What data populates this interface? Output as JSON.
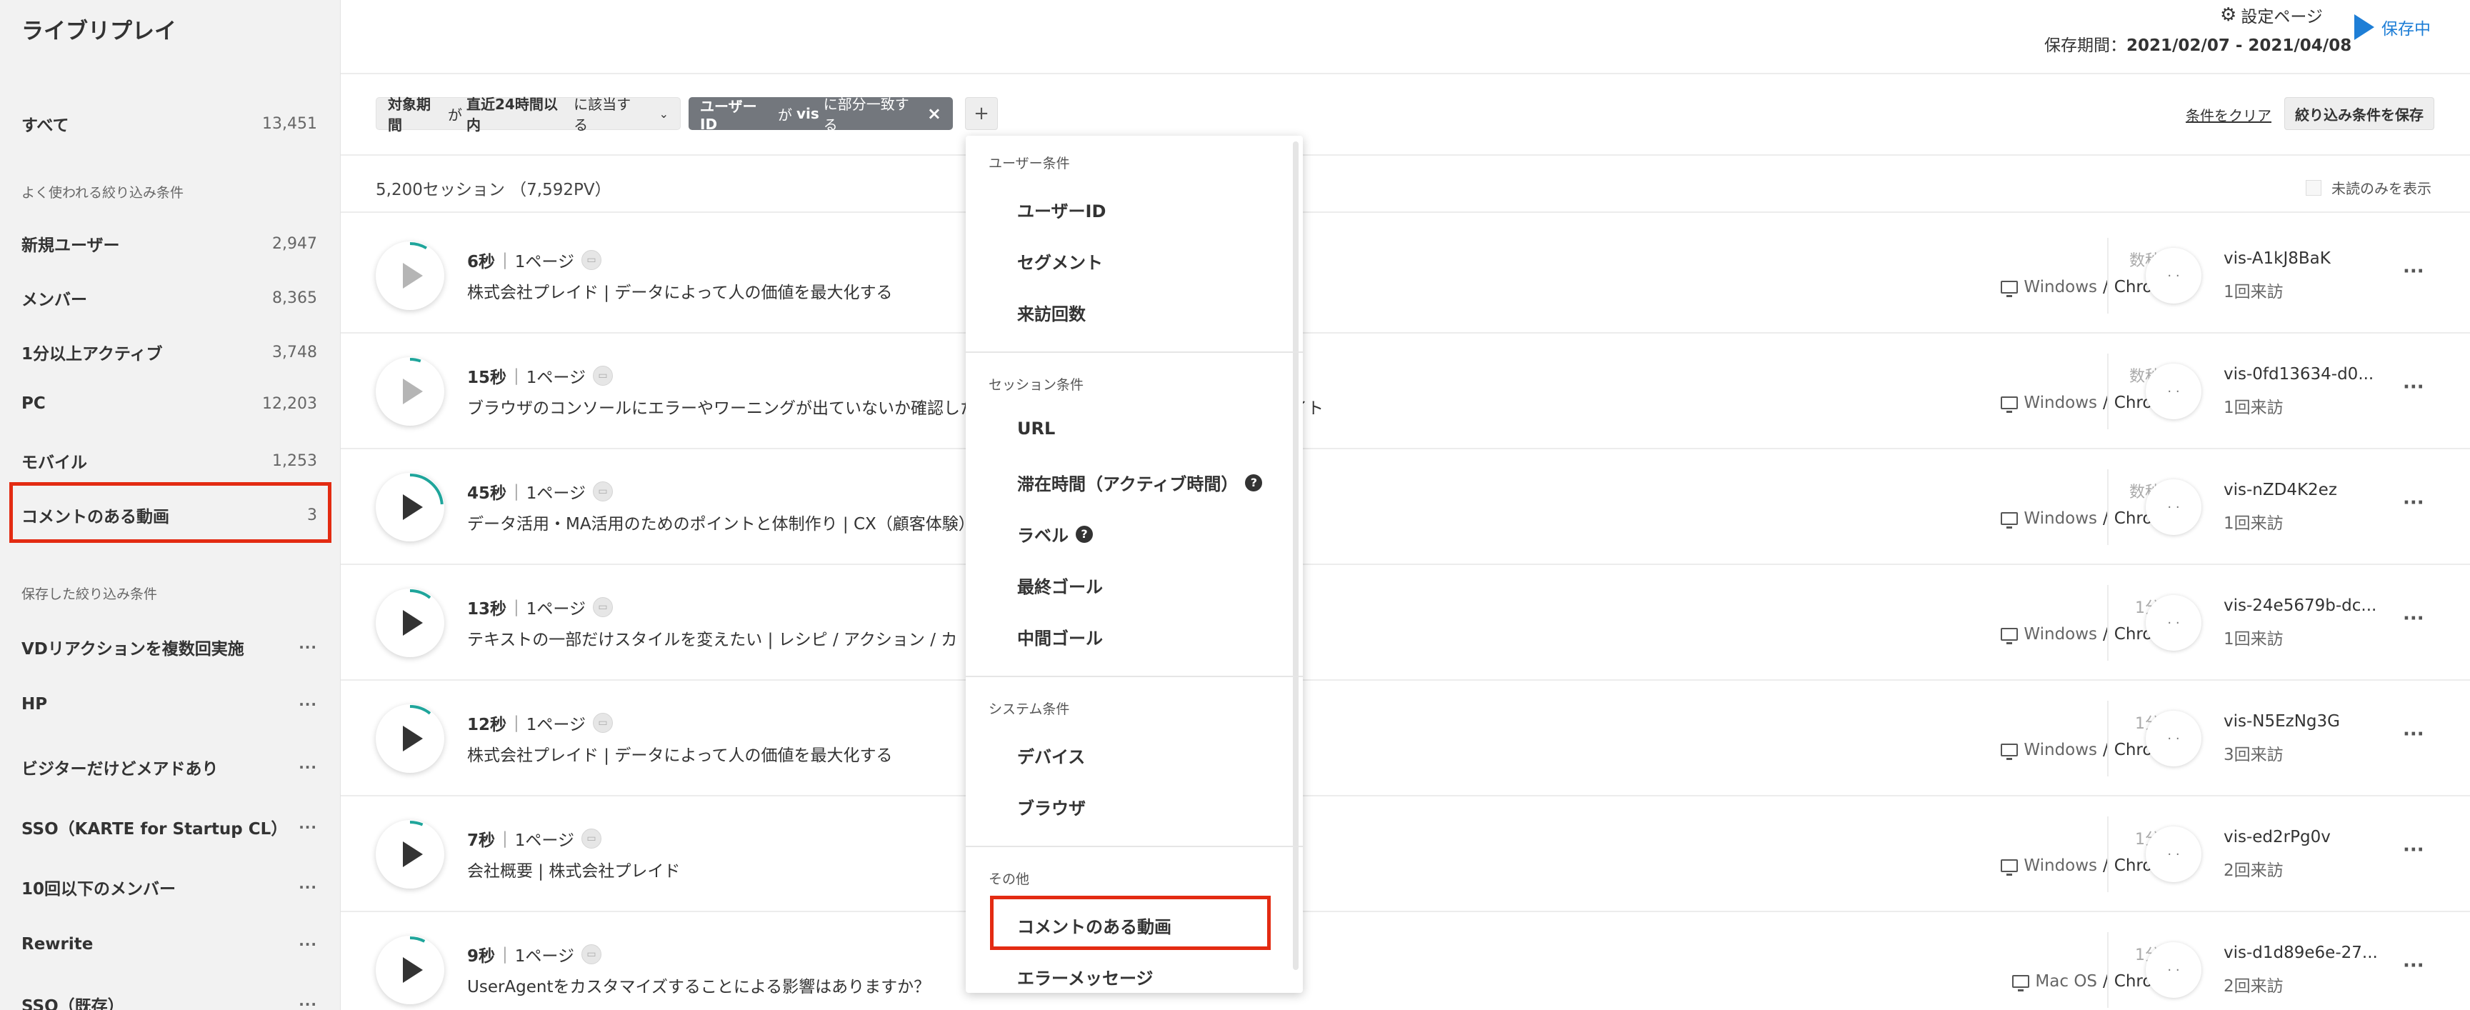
{
  "app": {
    "title": "ライブリプレイ"
  },
  "header": {
    "settings_label": "設定ページ",
    "period_label": "保存期間：",
    "period_value": "2021/02/07 - 2021/04/08",
    "saving_label": "保存中"
  },
  "sidebar": {
    "all": {
      "label": "すべて",
      "count": "13,451"
    },
    "frequent_title": "よく使われる絞り込み条件",
    "frequent": [
      {
        "label": "新規ユーザー",
        "count": "2,947"
      },
      {
        "label": "メンバー",
        "count": "8,365"
      },
      {
        "label": "1分以上アクティブ",
        "count": "3,748"
      },
      {
        "label": "PC",
        "count": "12,203"
      },
      {
        "label": "モバイル",
        "count": "1,253"
      },
      {
        "label": "コメントのある動画",
        "count": "3"
      }
    ],
    "saved_title": "保存した絞り込み条件",
    "saved": [
      {
        "label": "VDリアクションを複数回実施",
        "more": "···"
      },
      {
        "label": "HP",
        "more": "···"
      },
      {
        "label": "ビジターだけどメアドあり",
        "more": "···"
      },
      {
        "label": "SSO（KARTE for Startup CL）",
        "more": "···"
      },
      {
        "label": "10回以下のメンバー",
        "more": "···"
      },
      {
        "label": "Rewrite",
        "more": "···"
      },
      {
        "label": "SSO（既存）",
        "more": "···"
      }
    ]
  },
  "filters": {
    "chip1": {
      "field": "対象期間",
      "ga": "が",
      "value": "直近24時間以内",
      "op": "に該当する"
    },
    "chip2": {
      "field": "ユーザーID",
      "ga": "が",
      "value": "vis",
      "op": "に部分一致する"
    },
    "add": "+",
    "clear": "条件をクリア",
    "save": "絞り込み条件を保存"
  },
  "list": {
    "summary": "5,200セッション （7,592PV）",
    "unread_only": "未読のみを表示",
    "sessions": [
      {
        "duration": "6秒",
        "pages": "1ページ",
        "title": "株式会社プレイド | データによって人の価値を最大化する",
        "time": "数秒前",
        "os": "Windows",
        "browser": "Chrome",
        "vis_id": "vis-A1kJ8BaK",
        "visits": "1回来訪",
        "progress": 0.08
      },
      {
        "duration": "15秒",
        "pages": "1ページ",
        "title": "ブラウザのコンソールにエラーやワーニングが出ていないか確認したい | トラブルシュート | KARTEサポートサイト",
        "time": "数秒前",
        "os": "Windows",
        "browser": "Chrome",
        "vis_id": "vis-0fd13634-d0...",
        "visits": "1回来訪",
        "progress": 0.05
      },
      {
        "duration": "45秒",
        "pages": "1ページ",
        "title": "データ活用・MA活用のためのポイントと体制作り | CX（顧客体験）",
        "time": "数秒前",
        "os": "Windows",
        "browser": "Chrome",
        "vis_id": "vis-nZD4K2ez",
        "visits": "1回来訪",
        "progress": 0.22
      },
      {
        "duration": "13秒",
        "pages": "1ページ",
        "title": "テキストの一部だけスタイルを変えたい | レシピ / アクション / カ",
        "time": "1分前",
        "os": "Windows",
        "browser": "Chrome",
        "vis_id": "vis-24e5679b-dc...",
        "visits": "1回来訪",
        "progress": 0.1
      },
      {
        "duration": "12秒",
        "pages": "1ページ",
        "title": "株式会社プレイド | データによって人の価値を最大化する",
        "time": "1分前",
        "os": "Windows",
        "browser": "Chrome",
        "vis_id": "vis-N5EzNg3G",
        "visits": "3回来訪",
        "progress": 0.1
      },
      {
        "duration": "7秒",
        "pages": "1ページ",
        "title": "会社概要 | 株式会社プレイド",
        "time": "1分前",
        "os": "Windows",
        "browser": "Chrome",
        "vis_id": "vis-ed2rPg0v",
        "visits": "2回来訪",
        "progress": 0.06
      },
      {
        "duration": "9秒",
        "pages": "1ページ",
        "title": "UserAgentをカスタマイズすることによる影響はありますか？",
        "time": "1分前",
        "os": "Mac OS",
        "browser": "Chrome",
        "vis_id": "vis-d1d89e6e-27...",
        "visits": "2回来訪",
        "progress": 0.07
      }
    ]
  },
  "dropdown": {
    "user_title": "ユーザー条件",
    "user_items": [
      "ユーザーID",
      "セグメント",
      "来訪回数"
    ],
    "session_title": "セッション条件",
    "session_items": [
      "URL",
      "滞在時間（アクティブ時間）",
      "ラベル",
      "最終ゴール",
      "中間ゴール"
    ],
    "system_title": "システム条件",
    "system_items": [
      "デバイス",
      "ブラウザ"
    ],
    "other_title": "その他",
    "other_items": [
      "コメントのある動画",
      "エラーメッセージ"
    ]
  },
  "colors": {
    "accent": "#1e7ed6",
    "highlight": "#e32b12",
    "progress": "#1fa59b"
  }
}
